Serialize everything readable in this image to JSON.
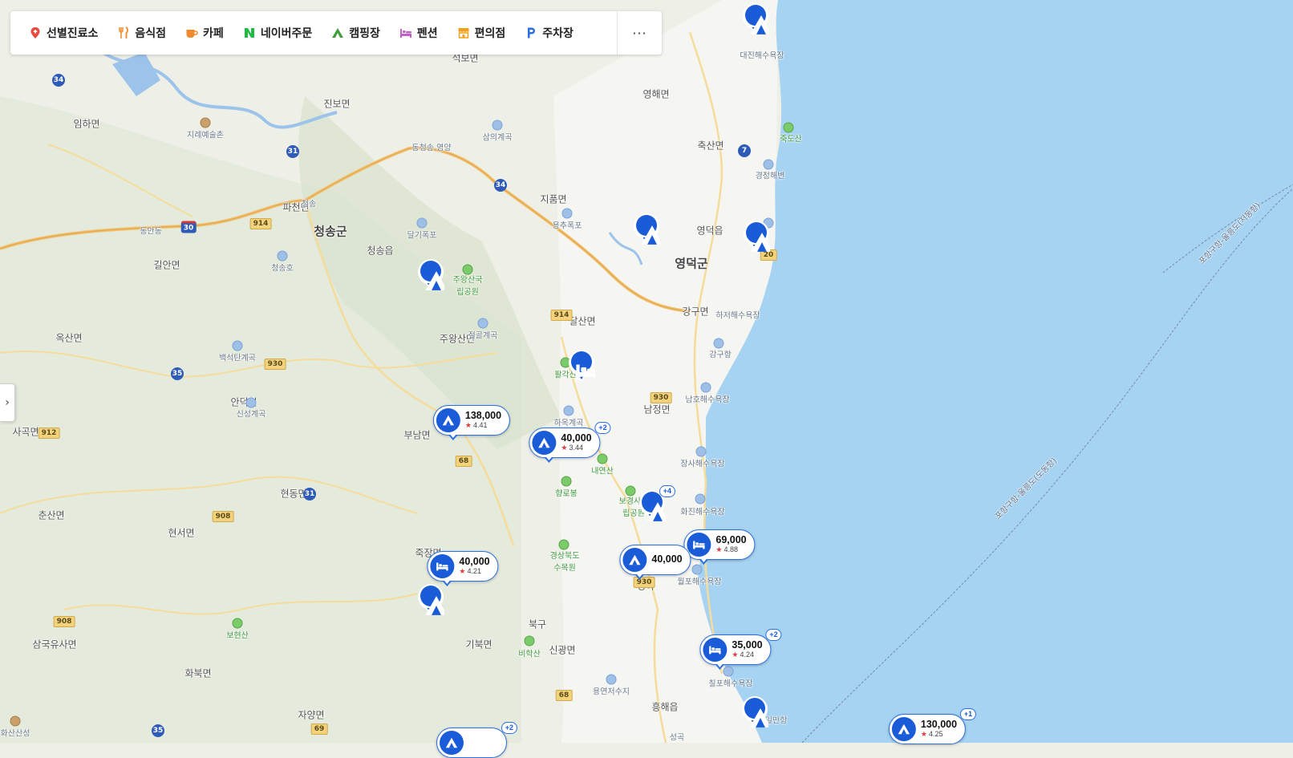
{
  "categories": [
    {
      "label": "선별진료소",
      "icon": "map-pin-icon",
      "color": "#e84a3f"
    },
    {
      "label": "음식점",
      "icon": "utensils-icon",
      "color": "#f08a2c"
    },
    {
      "label": "카페",
      "icon": "coffee-cup-icon",
      "color": "#f08a2c"
    },
    {
      "label": "네이버주문",
      "icon": "naver-n-icon",
      "color": "#1fbb45"
    },
    {
      "label": "캠핑장",
      "icon": "tent-icon",
      "color": "#3f9e3a"
    },
    {
      "label": "펜션",
      "icon": "bed-icon",
      "color": "#c25fc8"
    },
    {
      "label": "편의점",
      "icon": "store-icon",
      "color": "#f0a21c"
    },
    {
      "label": "주차장",
      "icon": "parking-icon",
      "color": "#2b6fe0"
    }
  ],
  "more_label": "···",
  "colors": {
    "sea": "#a6d3f2",
    "land": "#eef0e8",
    "marker": "#1a5bd8",
    "star": "#e83b3b"
  },
  "labels": {
    "county": [
      "청송군",
      "영덕군"
    ],
    "places": [
      "석보면",
      "진보면",
      "영해면",
      "축산면",
      "임하면",
      "파천면",
      "지품면",
      "영덕읍",
      "길안면",
      "청송읍",
      "강구면",
      "달산면",
      "옥산면",
      "주왕산면",
      "안덕면",
      "남정면",
      "사곡면",
      "부남면",
      "현동면",
      "춘산면",
      "현서면",
      "죽장면",
      "북구",
      "삼국유사면",
      "기북면",
      "신광면",
      "화북면",
      "흥해읍",
      "자양면",
      "대진해수욕장",
      "경정해변",
      "하저해수욕장",
      "강구항",
      "남호해수욕장",
      "장사해수욕장",
      "화진해수욕장",
      "월포해수욕장",
      "칠포해수욕장",
      "영일만항",
      "지례예술촌",
      "동청송.영양",
      "청송",
      "동안동",
      "청송호",
      "용추폭포",
      "삼의계곡",
      "달기폭포",
      "절골계곡",
      "백석탄계곡",
      "신성계곡",
      "하옥계곡",
      "용연저수지",
      "화산산성",
      "성곡",
      "청하",
      "죽도산",
      "내연산",
      "향로봉",
      "보현산",
      "비학산",
      "주왕산국립공원",
      "팔각산",
      "보경사군립공원",
      "경상북도수목원",
      "포항구항-울릉도(도동항)",
      "포항구항-울릉도(저동항)"
    ]
  },
  "routes": [
    "34",
    "31",
    "34",
    "914",
    "30",
    "35",
    "930",
    "912",
    "914",
    "930",
    "68",
    "31",
    "908",
    "908",
    "930",
    "68",
    "35",
    "69",
    "7",
    "20"
  ],
  "markers": [
    {
      "kind": "tent"
    },
    {
      "kind": "tent"
    },
    {
      "kind": "tent"
    },
    {
      "kind": "tent"
    },
    {
      "kind": "tent"
    },
    {
      "kind": "tent"
    },
    {
      "kind": "bed"
    },
    {
      "kind": "tent"
    },
    {
      "kind": "tent",
      "price": "138,000",
      "rating": "4.41"
    },
    {
      "kind": "tent",
      "price": "40,000",
      "rating": "3.44",
      "more": "+2"
    },
    {
      "kind": "bed",
      "price": "69,000",
      "rating": "4.88"
    },
    {
      "kind": "tent",
      "price": "40,000"
    },
    {
      "kind": "bed",
      "price": "40,000",
      "rating": "4.21"
    },
    {
      "kind": "bed",
      "price": "35,000",
      "rating": "4.24",
      "more": "+2"
    },
    {
      "kind": "tent",
      "price": "130,000",
      "rating": "4.25",
      "more": "+1"
    },
    {
      "kind": "tent",
      "more": "+4"
    },
    {
      "kind": "tent",
      "more": "+2"
    }
  ]
}
